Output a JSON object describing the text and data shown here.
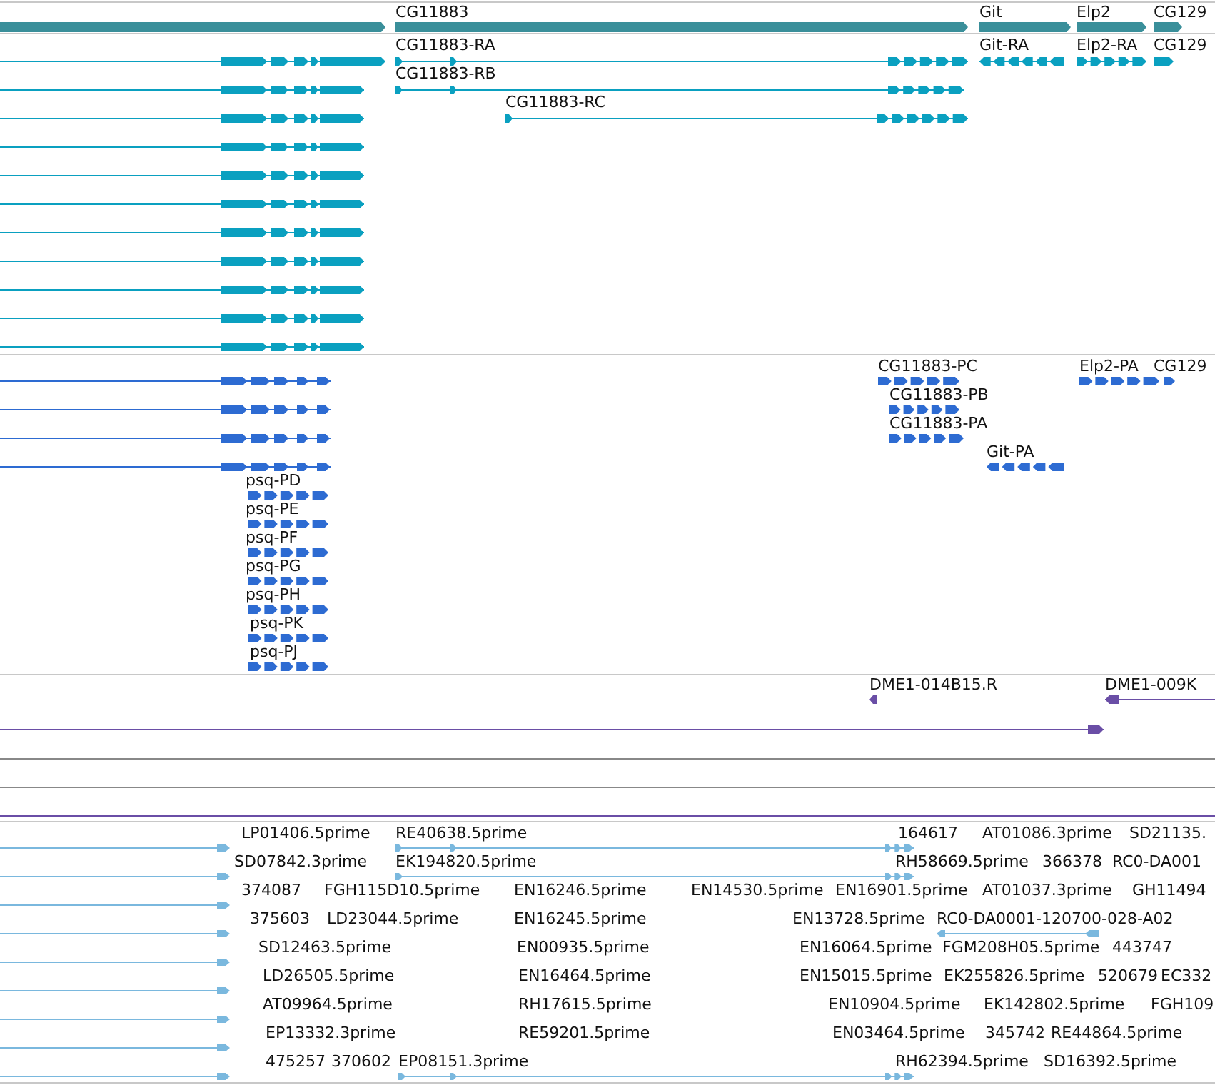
{
  "tracks": [
    {
      "kind": "gene",
      "labels": [
        "CG11883",
        "Git",
        "Elp2",
        "CG129"
      ]
    },
    {
      "kind": "transcript",
      "labels": [
        "CG11883-RA",
        "CG11883-RB",
        "CG11883-RC",
        "Git-RA",
        "Elp2-RA",
        "CG129"
      ]
    },
    {
      "kind": "protein",
      "labels": [
        "CG11883-PC",
        "CG11883-PB",
        "CG11883-PA",
        "Git-PA",
        "Elp2-PA",
        "CG129",
        "psq-PD",
        "psq-PE",
        "psq-PF",
        "psq-PG",
        "psq-PH",
        "psq-PK",
        "psq-PJ"
      ]
    },
    {
      "kind": "clone",
      "labels": [
        "DME1-014B15.R",
        "DME1-009K"
      ]
    },
    {
      "kind": "est",
      "labels": [
        "LP01406.5prime",
        "RE40638.5prime",
        "164617",
        "AT01086.3prime",
        "SD21135.",
        "SD07842.3prime",
        "EK194820.5prime",
        "RH58669.5prime",
        "366378",
        "RC0-DA001",
        "374087",
        "FGH115D10.5prime",
        "EN16246.5prime",
        "EN14530.5prime",
        "EN16901.5prime",
        "AT01037.3prime",
        "GH11494",
        "375603",
        "LD23044.5prime",
        "EN16245.5prime",
        "EN13728.5prime",
        "RC0-DA0001-120700-028-A02",
        "SD12463.5prime",
        "EN00935.5prime",
        "EN16064.5prime",
        "FGM208H05.5prime",
        "443747",
        "LD26505.5prime",
        "EN16464.5prime",
        "EN15015.5prime",
        "EK255826.5prime",
        "520679",
        "EC332",
        "AT09964.5prime",
        "RH17615.5prime",
        "EN10904.5prime",
        "EK142802.5prime",
        "FGH109",
        "EP13332.3prime",
        "RE59201.5prime",
        "EN03464.5prime",
        "345742",
        "RE44864.5prime",
        "475257",
        "370602",
        "EP08151.3prime",
        "RH62394.5prime",
        "SD16392.5prime"
      ]
    }
  ]
}
